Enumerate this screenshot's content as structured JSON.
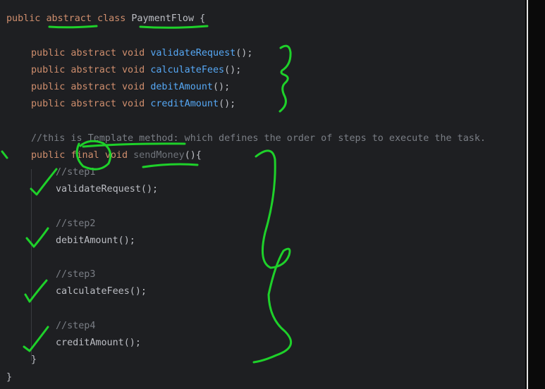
{
  "code": {
    "class_decl": {
      "kw_public": "public",
      "kw_abstract": "abstract",
      "kw_class": "class",
      "class_name": "PaymentFlow",
      "open_brace": "{"
    },
    "abstract_methods": [
      {
        "modifiers": "public abstract void",
        "name": "validateRequest",
        "suffix": "();"
      },
      {
        "modifiers": "public abstract void",
        "name": "calculateFees",
        "suffix": "();"
      },
      {
        "modifiers": "public abstract void",
        "name": "debitAmount",
        "suffix": "();"
      },
      {
        "modifiers": "public abstract void",
        "name": "creditAmount",
        "suffix": "();"
      }
    ],
    "template_comment": "//this is Template method: which defines the order of steps to execute the task.",
    "template_method": {
      "kw_public": "public",
      "kw_final": "final",
      "kw_void": "void",
      "name": "sendMoney",
      "suffix": "(){"
    },
    "steps": [
      {
        "comment": "//step1",
        "call": "validateRequest();"
      },
      {
        "comment": "//step2",
        "call": "debitAmount();"
      },
      {
        "comment": "//step3",
        "call": "calculateFees();"
      },
      {
        "comment": "//step4",
        "call": "creditAmount();"
      }
    ],
    "method_close": "}",
    "class_close": "}"
  },
  "colors": {
    "background": "#1e1f22",
    "keyword": "#cf8e6d",
    "method": "#56a8f5",
    "comment": "#7a7e85",
    "text": "#bcbec4",
    "annotation_ink": "#1ed12a"
  }
}
